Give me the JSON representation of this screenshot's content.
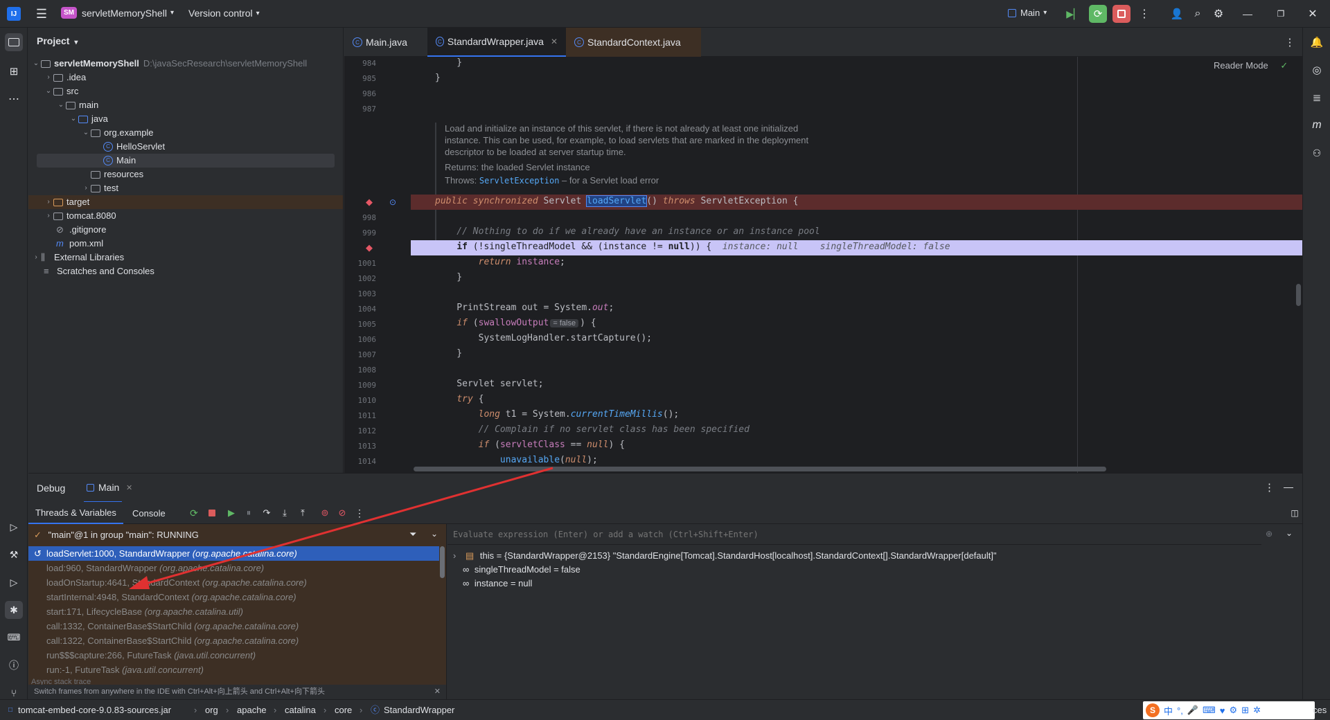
{
  "titlebar": {
    "project_badge": "SM",
    "project_name": "servletMemoryShell",
    "vcs": "Version control",
    "run_config": "Main"
  },
  "project_panel": {
    "title": "Project",
    "root": "servletMemoryShell",
    "root_path": "D:\\javaSecResearch\\servletMemoryShell",
    "items": {
      "idea": ".idea",
      "src": "src",
      "main": "main",
      "java": "java",
      "pkg": "org.example",
      "hello": "HelloServlet",
      "mainclass": "Main",
      "resources": "resources",
      "test": "test",
      "target": "target",
      "tomcat": "tomcat.8080",
      "gitignore": ".gitignore",
      "pom": "pom.xml",
      "ext": "External Libraries",
      "scratch": "Scratches and Consoles"
    }
  },
  "tabs": {
    "t1": "Main.java",
    "t2": "StandardWrapper.java",
    "t3": "StandardContext.java"
  },
  "editor": {
    "reader_mode": "Reader Mode",
    "doc1": "Load and initialize an instance of this servlet, if there is not already at least one initialized",
    "doc2": "instance. This can be used, for example, to load servlets that are marked in the deployment",
    "doc3": "descriptor to be loaded at server startup time.",
    "doc_returns": "Returns: the loaded Servlet instance",
    "doc_throws_label": "Throws: ",
    "doc_throws_type": "ServletException",
    "doc_throws_desc": " – for a Servlet load error",
    "line_numbers": {
      "n984": "984",
      "n985": "985",
      "n986": "986",
      "n987": "987",
      "n998": "998",
      "n999": "999",
      "n1001": "1001",
      "n1002": "1002",
      "n1003": "1003",
      "n1004": "1004",
      "n1005": "1005",
      "n1006": "1006",
      "n1007": "1007",
      "n1008": "1008",
      "n1009": "1009",
      "n1010": "1010",
      "n1011": "1011",
      "n1012": "1012",
      "n1013": "1013",
      "n1014": "1014"
    },
    "inline_hint_instance": "instance: null",
    "inline_hint_stm": "singleThreadModel: false",
    "inline_hint_swallow": "= false"
  },
  "debug": {
    "tab_debug": "Debug",
    "tab_main": "Main",
    "sub_threads": "Threads & Variables",
    "sub_console": "Console",
    "thread_status": "\"main\"@1 in group \"main\": RUNNING",
    "eval_placeholder": "Evaluate expression (Enter) or add a watch (Ctrl+Shift+Enter)",
    "frames": [
      {
        "name": "loadServlet:1000, StandardWrapper",
        "pkg": "(org.apache.catalina.core)"
      },
      {
        "name": "load:960, StandardWrapper",
        "pkg": "(org.apache.catalina.core)"
      },
      {
        "name": "loadOnStartup:4641, StandardContext",
        "pkg": "(org.apache.catalina.core)"
      },
      {
        "name": "startInternal:4948, StandardContext",
        "pkg": "(org.apache.catalina.core)"
      },
      {
        "name": "start:171, LifecycleBase",
        "pkg": "(org.apache.catalina.util)"
      },
      {
        "name": "call:1332, ContainerBase$StartChild",
        "pkg": "(org.apache.catalina.core)"
      },
      {
        "name": "call:1322, ContainerBase$StartChild",
        "pkg": "(org.apache.catalina.core)"
      },
      {
        "name": "run$$$capture:266, FutureTask",
        "pkg": "(java.util.concurrent)"
      },
      {
        "name": "run:-1, FutureTask",
        "pkg": "(java.util.concurrent)"
      }
    ],
    "async_label": "Async stack trace",
    "hint": "Switch frames from anywhere in the IDE with Ctrl+Alt+向上箭头 and Ctrl+Alt+向下箭头",
    "vars": {
      "this_name": "this",
      "this_val": " = {StandardWrapper@2153} \"StandardEngine[Tomcat].StandardHost[localhost].StandardContext[].StandardWrapper[default]\"",
      "stm_name": "singleThreadModel",
      "stm_val": " = false",
      "inst_name": "instance",
      "inst_val": " = null"
    }
  },
  "statusbar": {
    "c1": "tomcat-embed-core-9.0.83-sources.jar",
    "c2": "org",
    "c3": "apache",
    "c4": "catalina",
    "c5": "core",
    "c6": "StandardWrapper",
    "tail": "ces"
  },
  "colors": {
    "breakpoint_line": "#5c2c2c",
    "execution_line": "#c8c4f7",
    "frames_bg": "#3d2f24",
    "selected_frame": "#2e5fba",
    "arrow": "#e03131"
  }
}
